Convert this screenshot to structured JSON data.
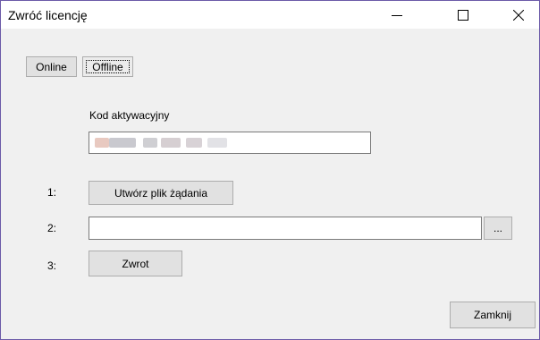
{
  "window": {
    "title": "Zwróć licencję",
    "controls": {
      "minimize_icon": "minimize-icon",
      "maximize_icon": "maximize-icon",
      "close_icon": "close-icon"
    }
  },
  "tabs": [
    {
      "label": "Online",
      "selected": false
    },
    {
      "label": "Offline",
      "selected": true
    }
  ],
  "activation": {
    "label": "Kod aktywacyjny",
    "value": "",
    "value_redacted": true
  },
  "steps": [
    {
      "number": "1:",
      "button_label": "Utwórz plik żądania"
    },
    {
      "number": "2:",
      "file_value": "",
      "browse_label": "..."
    },
    {
      "number": "3:",
      "button_label": "Zwrot"
    }
  ],
  "footer": {
    "close_label": "Zamknij"
  },
  "colors": {
    "window_border": "#6b5aa8",
    "client_bg": "#f0f0f0",
    "button_bg": "#e1e1e1",
    "button_border": "#adadad"
  }
}
